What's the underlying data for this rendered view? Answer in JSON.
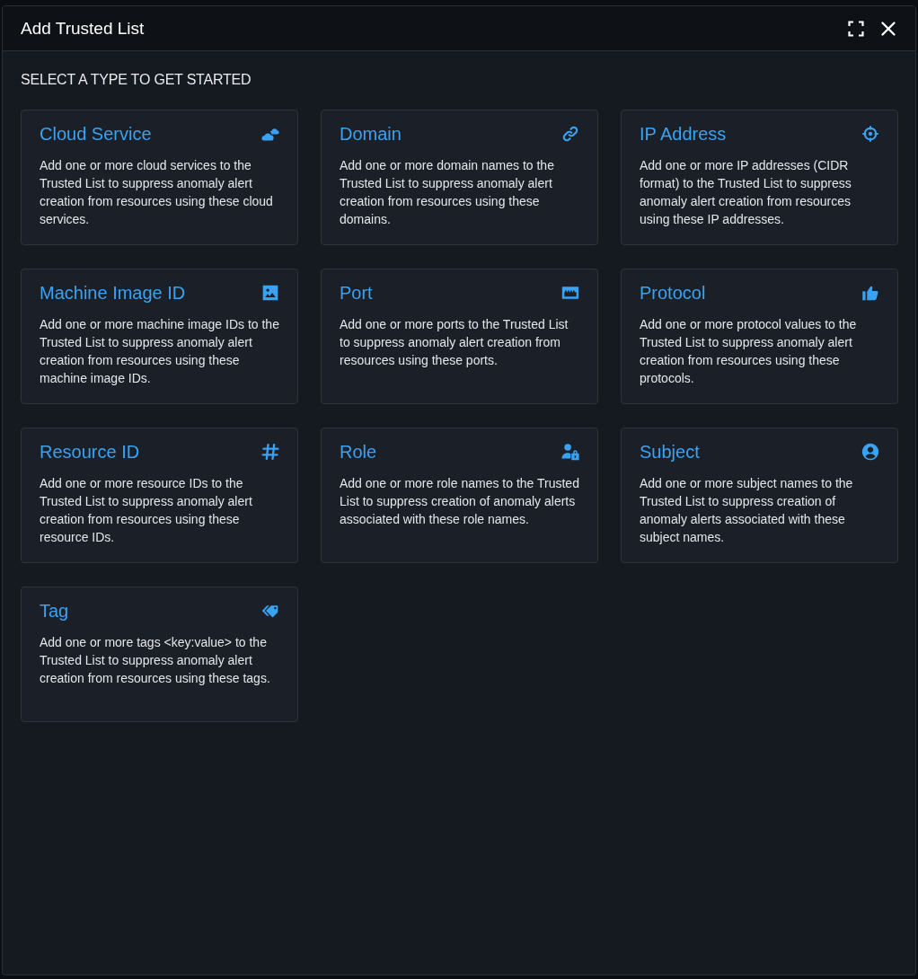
{
  "dialog": {
    "title": "Add Trusted List",
    "heading": "SELECT A TYPE TO GET STARTED"
  },
  "types": [
    {
      "kind": "cloud",
      "title": "Cloud Service",
      "description": "Add one or more cloud services to the Trusted List to suppress anomaly alert creation from resources using these cloud services."
    },
    {
      "kind": "domain",
      "title": "Domain",
      "description": "Add one or more domain names to the Trusted List to suppress anomaly alert creation from resources using these domains."
    },
    {
      "kind": "ip",
      "title": "IP Address",
      "description": "Add one or more IP addresses (CIDR format) to the Trusted List to suppress anomaly alert creation from resources using these IP addresses."
    },
    {
      "kind": "image",
      "title": "Machine Image ID",
      "description": "Add one or more machine image IDs to the Trusted List to suppress anomaly alert creation from resources using these machine image IDs."
    },
    {
      "kind": "port",
      "title": "Port",
      "description": "Add one or more ports to the Trusted List to suppress anomaly alert creation from resources using these ports."
    },
    {
      "kind": "protocol",
      "title": "Protocol",
      "description": "Add one or more protocol values to the Trusted List to suppress anomaly alert creation from resources using these protocols."
    },
    {
      "kind": "resource",
      "title": "Resource ID",
      "description": "Add one or more resource IDs to the Trusted List to suppress anomaly alert creation from resources using these resource IDs."
    },
    {
      "kind": "role",
      "title": "Role",
      "description": "Add one or more role names to the Trusted List to suppress creation of anomaly alerts associated with these role names."
    },
    {
      "kind": "subject",
      "title": "Subject",
      "description": "Add one or more subject names to the Trusted List to suppress creation of anomaly alerts associated with these subject names."
    },
    {
      "kind": "tag",
      "title": "Tag",
      "description": "Add one or more tags <key:value> to the Trusted List to suppress anomaly alert creation from resources using these tags."
    }
  ]
}
